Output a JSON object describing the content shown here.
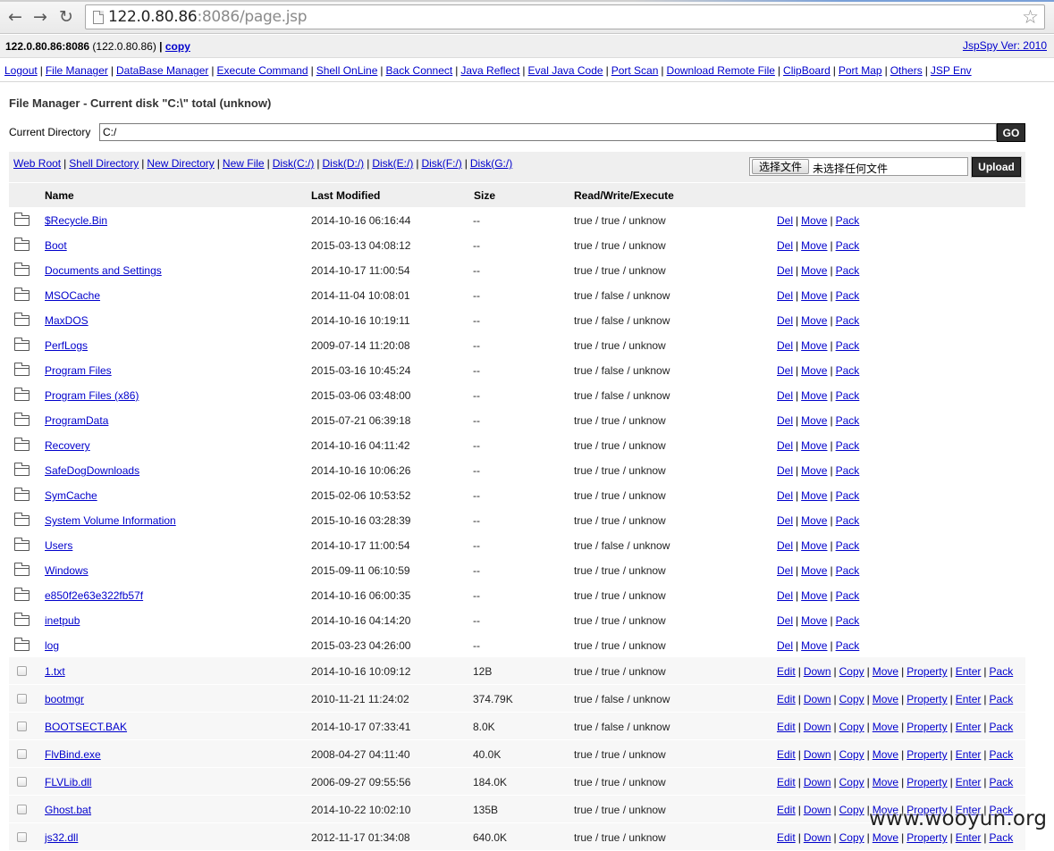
{
  "browser": {
    "back_icon": "←",
    "forward_icon": "→",
    "reload_icon": "↻",
    "url_host": "122.0.80.86",
    "url_rest": ":8086/page.jsp",
    "bookmark_icon": "☆"
  },
  "header": {
    "host_bold": "122.0.80.86:8086",
    "host_ip": " (122.0.80.86) ",
    "pipe": "|",
    "copy_label": "copy",
    "version": "JspSpy Ver: 2010"
  },
  "menu": [
    "Logout",
    "File Manager",
    "DataBase Manager",
    "Execute Command",
    "Shell OnLine",
    "Back Connect",
    "Java Reflect",
    "Eval Java Code",
    "Port Scan",
    "Download Remote File",
    "ClipBoard",
    "Port Map",
    "Others",
    "JSP Env"
  ],
  "page": {
    "title": "File Manager - Current disk \"C:\\\" total (unknow)",
    "current_directory_label": "Current Directory",
    "current_directory_value": "C:/",
    "go_label": "GO"
  },
  "toolbar_links": [
    "Web Root",
    "Shell Directory",
    "New Directory",
    "New File",
    "Disk(C:/)",
    "Disk(D:/)",
    "Disk(E:/)",
    "Disk(F:/)",
    "Disk(G:/)"
  ],
  "upload": {
    "choose_label": "选择文件",
    "no_file_label": "未选择任何文件",
    "upload_label": "Upload"
  },
  "table": {
    "headers": {
      "name": "Name",
      "modified": "Last Modified",
      "size": "Size",
      "rwx": "Read/Write/Execute"
    },
    "dir_actions": [
      "Del",
      "Move",
      "Pack"
    ],
    "file_actions": [
      "Edit",
      "Down",
      "Copy",
      "Move",
      "Property",
      "Enter",
      "Pack"
    ],
    "dirs": [
      {
        "name": "$Recycle.Bin",
        "modified": "2014-10-16 06:16:44",
        "size": "--",
        "rwx": "true / true / unknow"
      },
      {
        "name": "Boot",
        "modified": "2015-03-13 04:08:12",
        "size": "--",
        "rwx": "true / true / unknow"
      },
      {
        "name": "Documents and Settings",
        "modified": "2014-10-17 11:00:54",
        "size": "--",
        "rwx": "true / true / unknow"
      },
      {
        "name": "MSOCache",
        "modified": "2014-11-04 10:08:01",
        "size": "--",
        "rwx": "true / false / unknow"
      },
      {
        "name": "MaxDOS",
        "modified": "2014-10-16 10:19:11",
        "size": "--",
        "rwx": "true / false / unknow"
      },
      {
        "name": "PerfLogs",
        "modified": "2009-07-14 11:20:08",
        "size": "--",
        "rwx": "true / true / unknow"
      },
      {
        "name": "Program Files",
        "modified": "2015-03-16 10:45:24",
        "size": "--",
        "rwx": "true / false / unknow"
      },
      {
        "name": "Program Files (x86)",
        "modified": "2015-03-06 03:48:00",
        "size": "--",
        "rwx": "true / false / unknow"
      },
      {
        "name": "ProgramData",
        "modified": "2015-07-21 06:39:18",
        "size": "--",
        "rwx": "true / true / unknow"
      },
      {
        "name": "Recovery",
        "modified": "2014-10-16 04:11:42",
        "size": "--",
        "rwx": "true / true / unknow"
      },
      {
        "name": "SafeDogDownloads",
        "modified": "2014-10-16 10:06:26",
        "size": "--",
        "rwx": "true / true / unknow"
      },
      {
        "name": "SymCache",
        "modified": "2015-02-06 10:53:52",
        "size": "--",
        "rwx": "true / true / unknow"
      },
      {
        "name": "System Volume Information",
        "modified": "2015-10-16 03:28:39",
        "size": "--",
        "rwx": "true / true / unknow"
      },
      {
        "name": "Users",
        "modified": "2014-10-17 11:00:54",
        "size": "--",
        "rwx": "true / false / unknow"
      },
      {
        "name": "Windows",
        "modified": "2015-09-11 06:10:59",
        "size": "--",
        "rwx": "true / true / unknow"
      },
      {
        "name": "e850f2e63e322fb57f",
        "modified": "2014-10-16 06:00:35",
        "size": "--",
        "rwx": "true / true / unknow"
      },
      {
        "name": "inetpub",
        "modified": "2014-10-16 04:14:20",
        "size": "--",
        "rwx": "true / true / unknow"
      },
      {
        "name": "log",
        "modified": "2015-03-23 04:26:00",
        "size": "--",
        "rwx": "true / true / unknow"
      }
    ],
    "files": [
      {
        "name": "1.txt",
        "modified": "2014-10-16 10:09:12",
        "size": "12B",
        "rwx": "true / true / unknow"
      },
      {
        "name": "bootmgr",
        "modified": "2010-11-21 11:24:02",
        "size": "374.79K",
        "rwx": "true / false / unknow"
      },
      {
        "name": "BOOTSECT.BAK",
        "modified": "2014-10-17 07:33:41",
        "size": "8.0K",
        "rwx": "true / false / unknow"
      },
      {
        "name": "FlvBind.exe",
        "modified": "2008-04-27 04:11:40",
        "size": "40.0K",
        "rwx": "true / true / unknow"
      },
      {
        "name": "FLVLib.dll",
        "modified": "2006-09-27 09:55:56",
        "size": "184.0K",
        "rwx": "true / true / unknow"
      },
      {
        "name": "Ghost.bat",
        "modified": "2014-10-22 10:02:10",
        "size": "135B",
        "rwx": "true / true / unknow"
      },
      {
        "name": "js32.dll",
        "modified": "2012-11-17 01:34:08",
        "size": "640.0K",
        "rwx": "true / true / unknow"
      }
    ]
  },
  "watermark": "www.wooyun.org",
  "icons": {
    "folder": "folder-icon",
    "file_checkbox": "checkbox-icon",
    "page": "page-icon"
  }
}
